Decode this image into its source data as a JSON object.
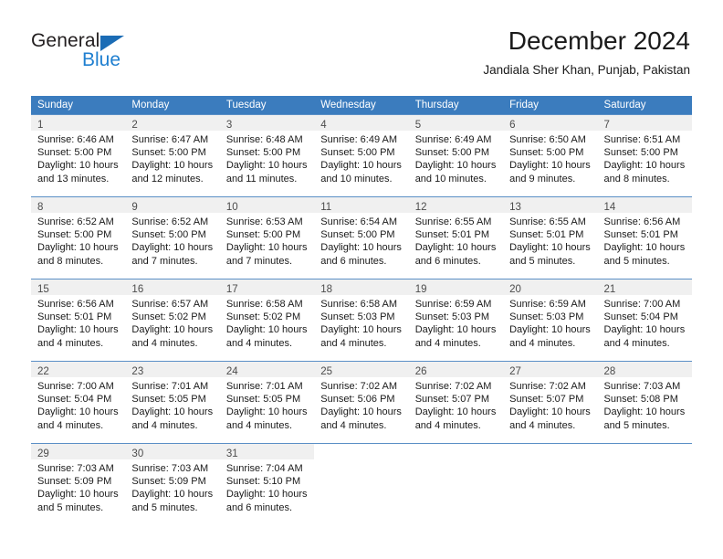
{
  "brand": {
    "word_one": "General",
    "word_two": "Blue",
    "triangle_color": "#1b6cb5",
    "blue_color": "#1f7fd0"
  },
  "header": {
    "title": "December 2024",
    "subtitle": "Jandiala Sher Khan, Punjab, Pakistan"
  },
  "theme": {
    "header_row_bg": "#3b7cbe",
    "header_row_text": "#ffffff",
    "daynum_band_bg": "#f0f0f0",
    "row_divider": "#5a8fc6",
    "body_text": "#1a1a1a",
    "daynum_text": "#4c4c4c"
  },
  "calendar": {
    "day_headers": [
      "Sunday",
      "Monday",
      "Tuesday",
      "Wednesday",
      "Thursday",
      "Friday",
      "Saturday"
    ],
    "weeks": [
      [
        {
          "day": "1",
          "sunrise": "Sunrise: 6:46 AM",
          "sunset": "Sunset: 5:00 PM",
          "daylight_1": "Daylight: 10 hours",
          "daylight_2": "and 13 minutes."
        },
        {
          "day": "2",
          "sunrise": "Sunrise: 6:47 AM",
          "sunset": "Sunset: 5:00 PM",
          "daylight_1": "Daylight: 10 hours",
          "daylight_2": "and 12 minutes."
        },
        {
          "day": "3",
          "sunrise": "Sunrise: 6:48 AM",
          "sunset": "Sunset: 5:00 PM",
          "daylight_1": "Daylight: 10 hours",
          "daylight_2": "and 11 minutes."
        },
        {
          "day": "4",
          "sunrise": "Sunrise: 6:49 AM",
          "sunset": "Sunset: 5:00 PM",
          "daylight_1": "Daylight: 10 hours",
          "daylight_2": "and 10 minutes."
        },
        {
          "day": "5",
          "sunrise": "Sunrise: 6:49 AM",
          "sunset": "Sunset: 5:00 PM",
          "daylight_1": "Daylight: 10 hours",
          "daylight_2": "and 10 minutes."
        },
        {
          "day": "6",
          "sunrise": "Sunrise: 6:50 AM",
          "sunset": "Sunset: 5:00 PM",
          "daylight_1": "Daylight: 10 hours",
          "daylight_2": "and 9 minutes."
        },
        {
          "day": "7",
          "sunrise": "Sunrise: 6:51 AM",
          "sunset": "Sunset: 5:00 PM",
          "daylight_1": "Daylight: 10 hours",
          "daylight_2": "and 8 minutes."
        }
      ],
      [
        {
          "day": "8",
          "sunrise": "Sunrise: 6:52 AM",
          "sunset": "Sunset: 5:00 PM",
          "daylight_1": "Daylight: 10 hours",
          "daylight_2": "and 8 minutes."
        },
        {
          "day": "9",
          "sunrise": "Sunrise: 6:52 AM",
          "sunset": "Sunset: 5:00 PM",
          "daylight_1": "Daylight: 10 hours",
          "daylight_2": "and 7 minutes."
        },
        {
          "day": "10",
          "sunrise": "Sunrise: 6:53 AM",
          "sunset": "Sunset: 5:00 PM",
          "daylight_1": "Daylight: 10 hours",
          "daylight_2": "and 7 minutes."
        },
        {
          "day": "11",
          "sunrise": "Sunrise: 6:54 AM",
          "sunset": "Sunset: 5:00 PM",
          "daylight_1": "Daylight: 10 hours",
          "daylight_2": "and 6 minutes."
        },
        {
          "day": "12",
          "sunrise": "Sunrise: 6:55 AM",
          "sunset": "Sunset: 5:01 PM",
          "daylight_1": "Daylight: 10 hours",
          "daylight_2": "and 6 minutes."
        },
        {
          "day": "13",
          "sunrise": "Sunrise: 6:55 AM",
          "sunset": "Sunset: 5:01 PM",
          "daylight_1": "Daylight: 10 hours",
          "daylight_2": "and 5 minutes."
        },
        {
          "day": "14",
          "sunrise": "Sunrise: 6:56 AM",
          "sunset": "Sunset: 5:01 PM",
          "daylight_1": "Daylight: 10 hours",
          "daylight_2": "and 5 minutes."
        }
      ],
      [
        {
          "day": "15",
          "sunrise": "Sunrise: 6:56 AM",
          "sunset": "Sunset: 5:01 PM",
          "daylight_1": "Daylight: 10 hours",
          "daylight_2": "and 4 minutes."
        },
        {
          "day": "16",
          "sunrise": "Sunrise: 6:57 AM",
          "sunset": "Sunset: 5:02 PM",
          "daylight_1": "Daylight: 10 hours",
          "daylight_2": "and 4 minutes."
        },
        {
          "day": "17",
          "sunrise": "Sunrise: 6:58 AM",
          "sunset": "Sunset: 5:02 PM",
          "daylight_1": "Daylight: 10 hours",
          "daylight_2": "and 4 minutes."
        },
        {
          "day": "18",
          "sunrise": "Sunrise: 6:58 AM",
          "sunset": "Sunset: 5:03 PM",
          "daylight_1": "Daylight: 10 hours",
          "daylight_2": "and 4 minutes."
        },
        {
          "day": "19",
          "sunrise": "Sunrise: 6:59 AM",
          "sunset": "Sunset: 5:03 PM",
          "daylight_1": "Daylight: 10 hours",
          "daylight_2": "and 4 minutes."
        },
        {
          "day": "20",
          "sunrise": "Sunrise: 6:59 AM",
          "sunset": "Sunset: 5:03 PM",
          "daylight_1": "Daylight: 10 hours",
          "daylight_2": "and 4 minutes."
        },
        {
          "day": "21",
          "sunrise": "Sunrise: 7:00 AM",
          "sunset": "Sunset: 5:04 PM",
          "daylight_1": "Daylight: 10 hours",
          "daylight_2": "and 4 minutes."
        }
      ],
      [
        {
          "day": "22",
          "sunrise": "Sunrise: 7:00 AM",
          "sunset": "Sunset: 5:04 PM",
          "daylight_1": "Daylight: 10 hours",
          "daylight_2": "and 4 minutes."
        },
        {
          "day": "23",
          "sunrise": "Sunrise: 7:01 AM",
          "sunset": "Sunset: 5:05 PM",
          "daylight_1": "Daylight: 10 hours",
          "daylight_2": "and 4 minutes."
        },
        {
          "day": "24",
          "sunrise": "Sunrise: 7:01 AM",
          "sunset": "Sunset: 5:05 PM",
          "daylight_1": "Daylight: 10 hours",
          "daylight_2": "and 4 minutes."
        },
        {
          "day": "25",
          "sunrise": "Sunrise: 7:02 AM",
          "sunset": "Sunset: 5:06 PM",
          "daylight_1": "Daylight: 10 hours",
          "daylight_2": "and 4 minutes."
        },
        {
          "day": "26",
          "sunrise": "Sunrise: 7:02 AM",
          "sunset": "Sunset: 5:07 PM",
          "daylight_1": "Daylight: 10 hours",
          "daylight_2": "and 4 minutes."
        },
        {
          "day": "27",
          "sunrise": "Sunrise: 7:02 AM",
          "sunset": "Sunset: 5:07 PM",
          "daylight_1": "Daylight: 10 hours",
          "daylight_2": "and 4 minutes."
        },
        {
          "day": "28",
          "sunrise": "Sunrise: 7:03 AM",
          "sunset": "Sunset: 5:08 PM",
          "daylight_1": "Daylight: 10 hours",
          "daylight_2": "and 5 minutes."
        }
      ],
      [
        {
          "day": "29",
          "sunrise": "Sunrise: 7:03 AM",
          "sunset": "Sunset: 5:09 PM",
          "daylight_1": "Daylight: 10 hours",
          "daylight_2": "and 5 minutes."
        },
        {
          "day": "30",
          "sunrise": "Sunrise: 7:03 AM",
          "sunset": "Sunset: 5:09 PM",
          "daylight_1": "Daylight: 10 hours",
          "daylight_2": "and 5 minutes."
        },
        {
          "day": "31",
          "sunrise": "Sunrise: 7:04 AM",
          "sunset": "Sunset: 5:10 PM",
          "daylight_1": "Daylight: 10 hours",
          "daylight_2": "and 6 minutes."
        },
        {
          "day": "",
          "sunrise": "",
          "sunset": "",
          "daylight_1": "",
          "daylight_2": ""
        },
        {
          "day": "",
          "sunrise": "",
          "sunset": "",
          "daylight_1": "",
          "daylight_2": ""
        },
        {
          "day": "",
          "sunrise": "",
          "sunset": "",
          "daylight_1": "",
          "daylight_2": ""
        },
        {
          "day": "",
          "sunrise": "",
          "sunset": "",
          "daylight_1": "",
          "daylight_2": ""
        }
      ]
    ]
  }
}
